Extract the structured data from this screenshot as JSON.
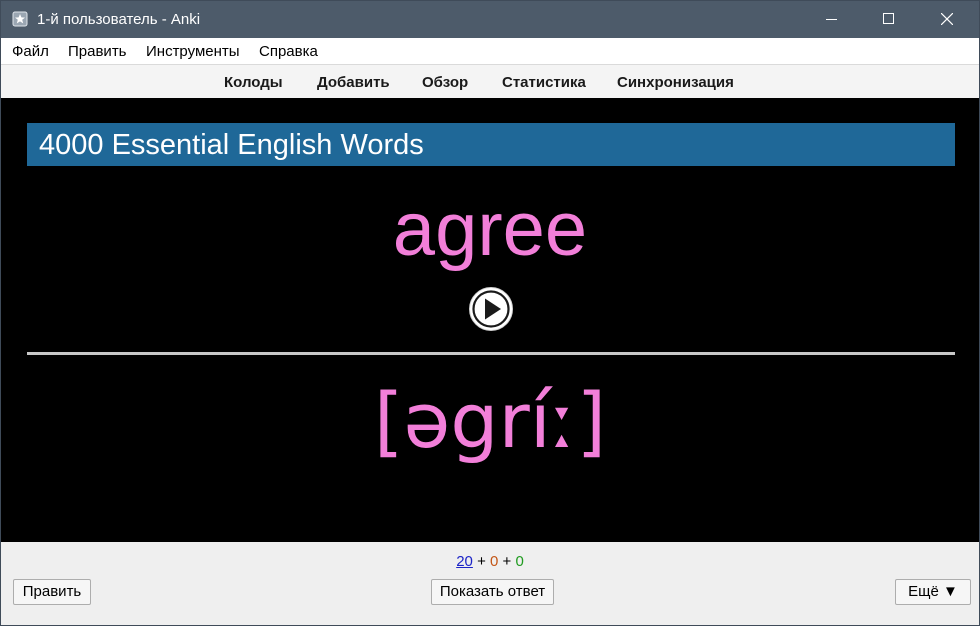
{
  "window": {
    "title": "1-й пользователь - Anki",
    "icons": {
      "app": "anki-app-icon",
      "minimize": "minimize-icon",
      "maximize": "maximize-icon",
      "close": "close-icon"
    }
  },
  "menu": {
    "items": [
      "Файл",
      "Править",
      "Инструменты",
      "Справка"
    ]
  },
  "toolbar": {
    "items": [
      "Колоды",
      "Добавить",
      "Обзор",
      "Статистика",
      "Синхронизация"
    ]
  },
  "card": {
    "deck_title": "4000 Essential English Words",
    "word": "agree",
    "transcription": "[əgríː]",
    "play_icon": "play-icon",
    "colors": {
      "banner": "#1f6898",
      "text": "#f27fd9",
      "background": "#000000"
    }
  },
  "bottom": {
    "counts": {
      "new": "20",
      "learning": "0",
      "review": "0",
      "separator": "+",
      "colors": {
        "new": "#1c24c7",
        "learning": "#c35617",
        "review": "#1f9b1f"
      }
    },
    "edit_label": "Править",
    "show_answer_label": "Показать ответ",
    "more_label": "Ещё ▼"
  }
}
